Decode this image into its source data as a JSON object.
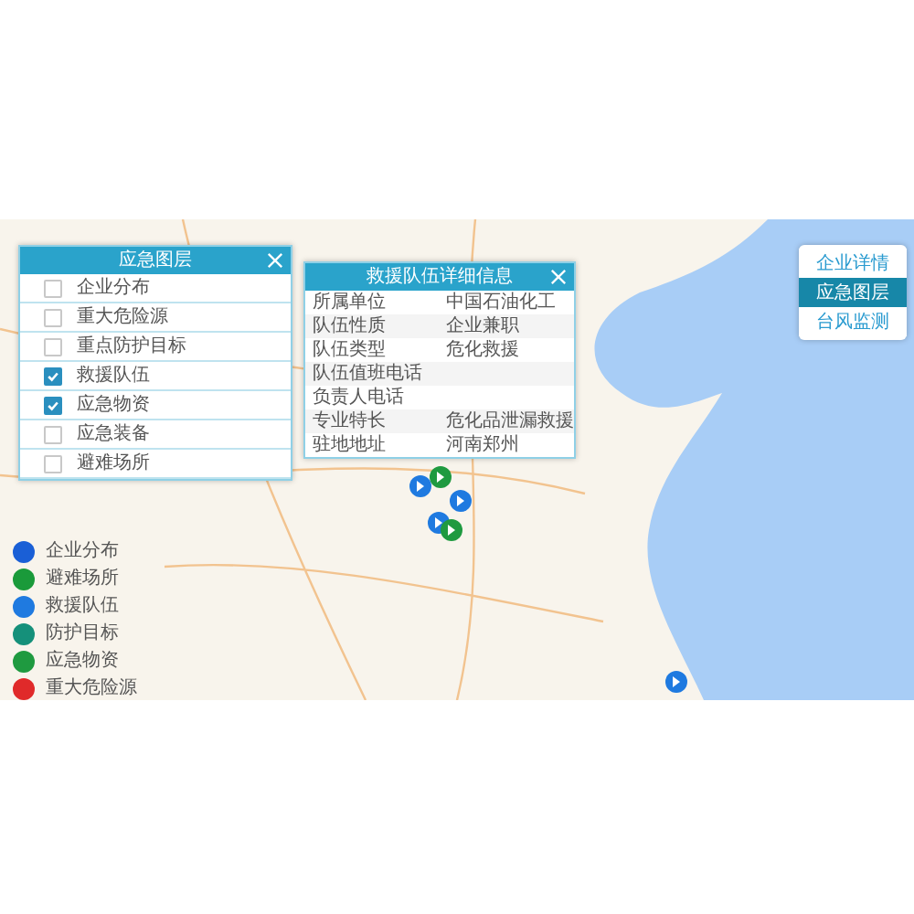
{
  "layer_panel": {
    "title": "应急图层",
    "items": [
      {
        "label": "企业分布",
        "checked": false
      },
      {
        "label": "重大危险源",
        "checked": false
      },
      {
        "label": "重点防护目标",
        "checked": false
      },
      {
        "label": "救援队伍",
        "checked": true
      },
      {
        "label": "应急物资",
        "checked": true
      },
      {
        "label": "应急装备",
        "checked": false
      },
      {
        "label": "避难场所",
        "checked": false
      }
    ]
  },
  "info_panel": {
    "title": "救援队伍详细信息",
    "rows": [
      {
        "label": "所属单位",
        "value": "中国石油化工"
      },
      {
        "label": "队伍性质",
        "value": "企业兼职"
      },
      {
        "label": "队伍类型",
        "value": "危化救援"
      },
      {
        "label": "队伍值班电话"
      },
      {
        "label": "负责人电话"
      },
      {
        "label": "专业特长",
        "value": "危化品泄漏救援"
      },
      {
        "label": "驻地地址",
        "value": "河南郑州"
      }
    ]
  },
  "side_buttons": [
    {
      "label": "企业详情",
      "selected": false
    },
    {
      "label": "应急图层",
      "selected": true
    },
    {
      "label": "台风监测",
      "selected": false
    }
  ],
  "legend": [
    {
      "label": "企业分布",
      "color": "#1a5fd6"
    },
    {
      "label": "避难场所",
      "color": "#1a9a3a"
    },
    {
      "label": "救援队伍",
      "color": "#1f7ae0"
    },
    {
      "label": "防护目标",
      "color": "#15907a"
    },
    {
      "label": "应急物资",
      "color": "#1f9a40"
    },
    {
      "label": "重大危险源",
      "color": "#e02a2a"
    }
  ]
}
